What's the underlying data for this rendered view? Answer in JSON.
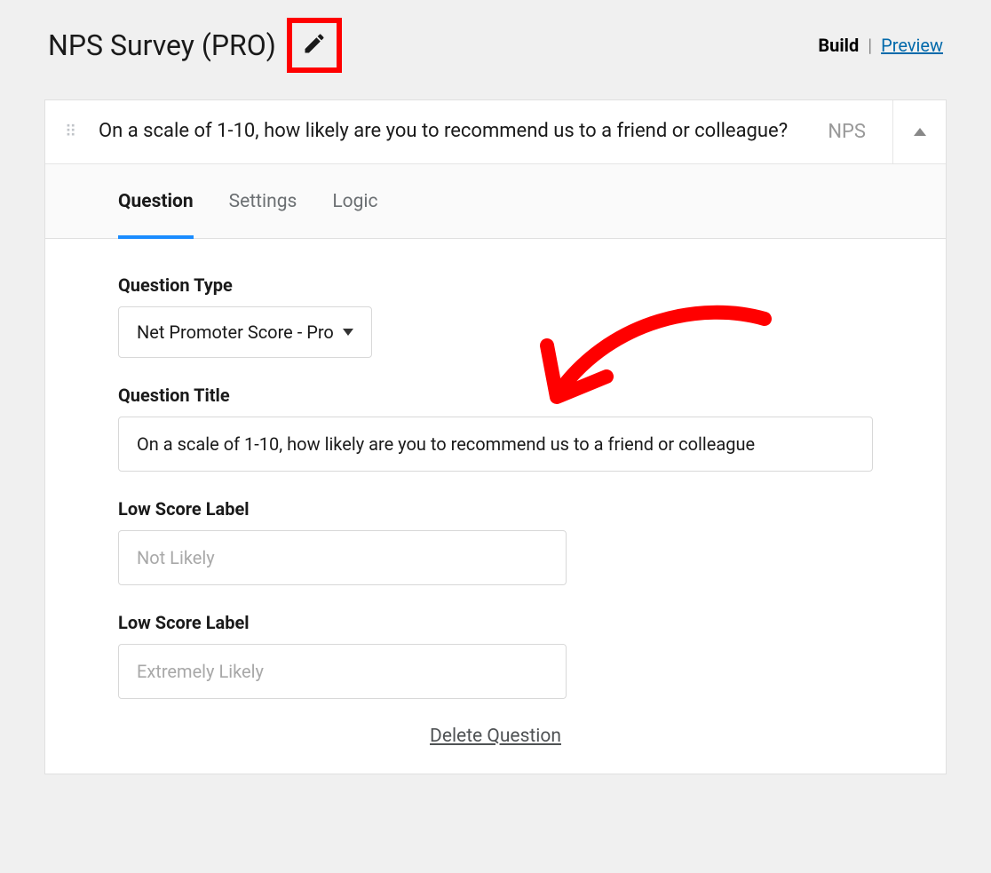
{
  "header": {
    "title": "NPS Survey (PRO)",
    "nav": {
      "build": "Build",
      "separator": "|",
      "preview": "Preview"
    }
  },
  "card": {
    "question_preview": "On a scale of 1-10, how likely are you to recommend us to a friend or colleague?",
    "badge": "NPS",
    "tabs": {
      "question": "Question",
      "settings": "Settings",
      "logic": "Logic"
    },
    "fields": {
      "question_type_label": "Question Type",
      "question_type_value": "Net Promoter Score - Pro",
      "question_title_label": "Question Title",
      "question_title_value": "On a scale of 1-10, how likely are you to recommend us to a friend or colleague",
      "low_score_label_1": "Low Score Label",
      "low_score_placeholder_1": "Not Likely",
      "low_score_label_2": "Low Score Label",
      "low_score_placeholder_2": "Extremely Likely"
    },
    "delete_label": "Delete Question"
  }
}
